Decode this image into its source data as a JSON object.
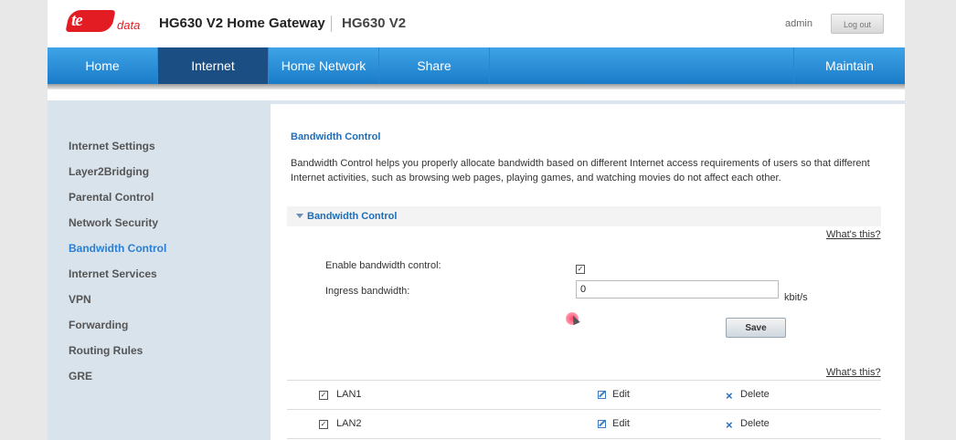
{
  "header": {
    "logo_text": "te",
    "logo_suffix": "data",
    "title": "HG630 V2 Home Gateway",
    "model": "HG630 V2",
    "user": "admin",
    "logout_label": "Log out"
  },
  "nav": [
    {
      "label": "Home"
    },
    {
      "label": "Internet"
    },
    {
      "label": "Home Network"
    },
    {
      "label": "Share"
    },
    {
      "label": "Maintain"
    }
  ],
  "sidebar": [
    {
      "label": "Internet Settings"
    },
    {
      "label": "Layer2Bridging"
    },
    {
      "label": "Parental Control"
    },
    {
      "label": "Network Security"
    },
    {
      "label": "Bandwidth Control"
    },
    {
      "label": "Internet Services"
    },
    {
      "label": "VPN"
    },
    {
      "label": "Forwarding"
    },
    {
      "label": "Routing Rules"
    },
    {
      "label": "GRE"
    }
  ],
  "main": {
    "title": "Bandwidth Control",
    "description": "Bandwidth Control helps you properly allocate bandwidth based on different Internet access requirements of users so that different Internet activities, such as browsing web pages, playing games, and watching movies do not affect each other.",
    "section_label": "Bandwidth Control",
    "whats_this": "What's this?",
    "enable_label": "Enable bandwidth control:",
    "enable_checked": true,
    "ingress_label": "Ingress bandwidth:",
    "ingress_value": "0",
    "unit": "kbit/s",
    "save_label": "Save",
    "rows": [
      {
        "name": "LAN1",
        "edit": "Edit",
        "delete": "Delete"
      },
      {
        "name": "LAN2",
        "edit": "Edit",
        "delete": "Delete"
      }
    ]
  }
}
